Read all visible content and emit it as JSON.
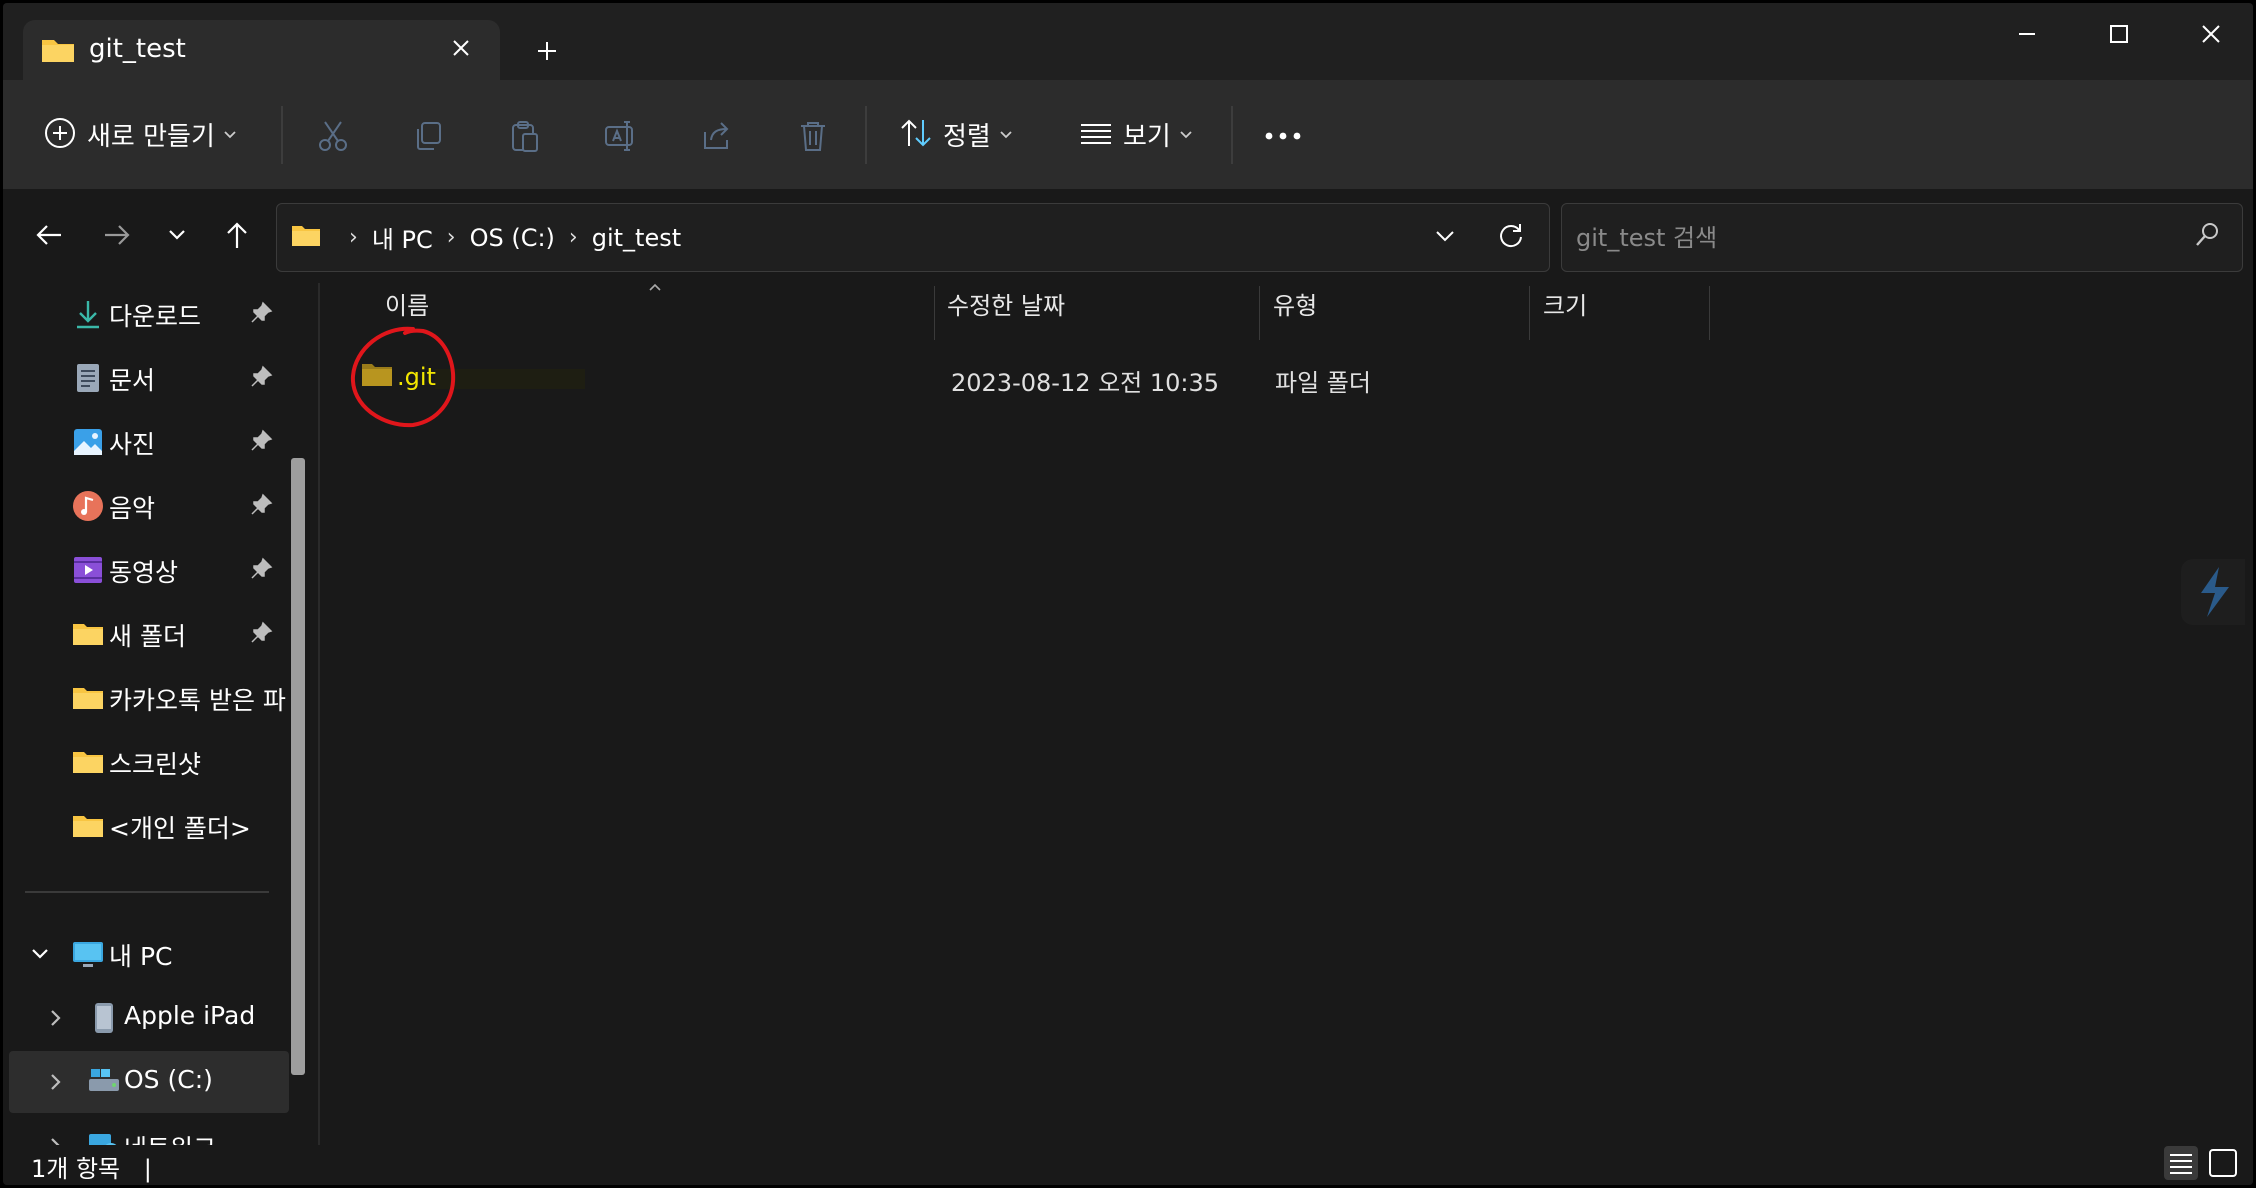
{
  "tab": {
    "title": "git_test",
    "close": "✕",
    "new": "+"
  },
  "window_controls": {
    "minimize": "—",
    "maximize": "☐",
    "close": "✕"
  },
  "commandbar": {
    "new_label": "새로 만들기",
    "sort_label": "정렬",
    "view_label": "보기",
    "more": "•••"
  },
  "address": {
    "crumbs": [
      "내 PC",
      "OS (C:)",
      "git_test"
    ],
    "separator": "›"
  },
  "search": {
    "placeholder": "git_test 검색"
  },
  "sidebar": {
    "quick_access": [
      {
        "label": "다운로드",
        "icon": "download-icon",
        "pinned": true
      },
      {
        "label": "문서",
        "icon": "document-icon",
        "pinned": true
      },
      {
        "label": "사진",
        "icon": "picture-icon",
        "pinned": true
      },
      {
        "label": "음악",
        "icon": "music-icon",
        "pinned": true
      },
      {
        "label": "동영상",
        "icon": "video-icon",
        "pinned": true
      },
      {
        "label": "새 폴더",
        "icon": "folder-icon",
        "pinned": true
      },
      {
        "label": "카카오톡 받은 파",
        "icon": "folder-icon",
        "pinned": false
      },
      {
        "label": "스크린샷",
        "icon": "folder-icon",
        "pinned": false
      },
      {
        "label": "<개인 폴더>",
        "icon": "folder-icon",
        "pinned": false
      }
    ],
    "tree": [
      {
        "label": "내 PC",
        "icon": "pc-icon",
        "expanded": true
      },
      {
        "label": "Apple iPad",
        "icon": "ipad-icon",
        "expanded": false
      },
      {
        "label": "OS (C:)",
        "icon": "drive-icon",
        "expanded": false,
        "selected": true
      },
      {
        "label": "네트워크",
        "icon": "network-icon",
        "expanded": false
      }
    ]
  },
  "columns": {
    "name": "이름",
    "modified": "수정한 날짜",
    "type": "유형",
    "size": "크기"
  },
  "files": [
    {
      "name": ".git",
      "modified": "2023-08-12 오전 10:35",
      "type": "파일 폴더",
      "size": ""
    }
  ],
  "status": {
    "count": "1개 항목",
    "cursor": "|"
  },
  "colors": {
    "folder": "#f8c542",
    "name_highlight": "#f2e600",
    "annotation": "#e0161b",
    "accent": "#60cdff"
  }
}
